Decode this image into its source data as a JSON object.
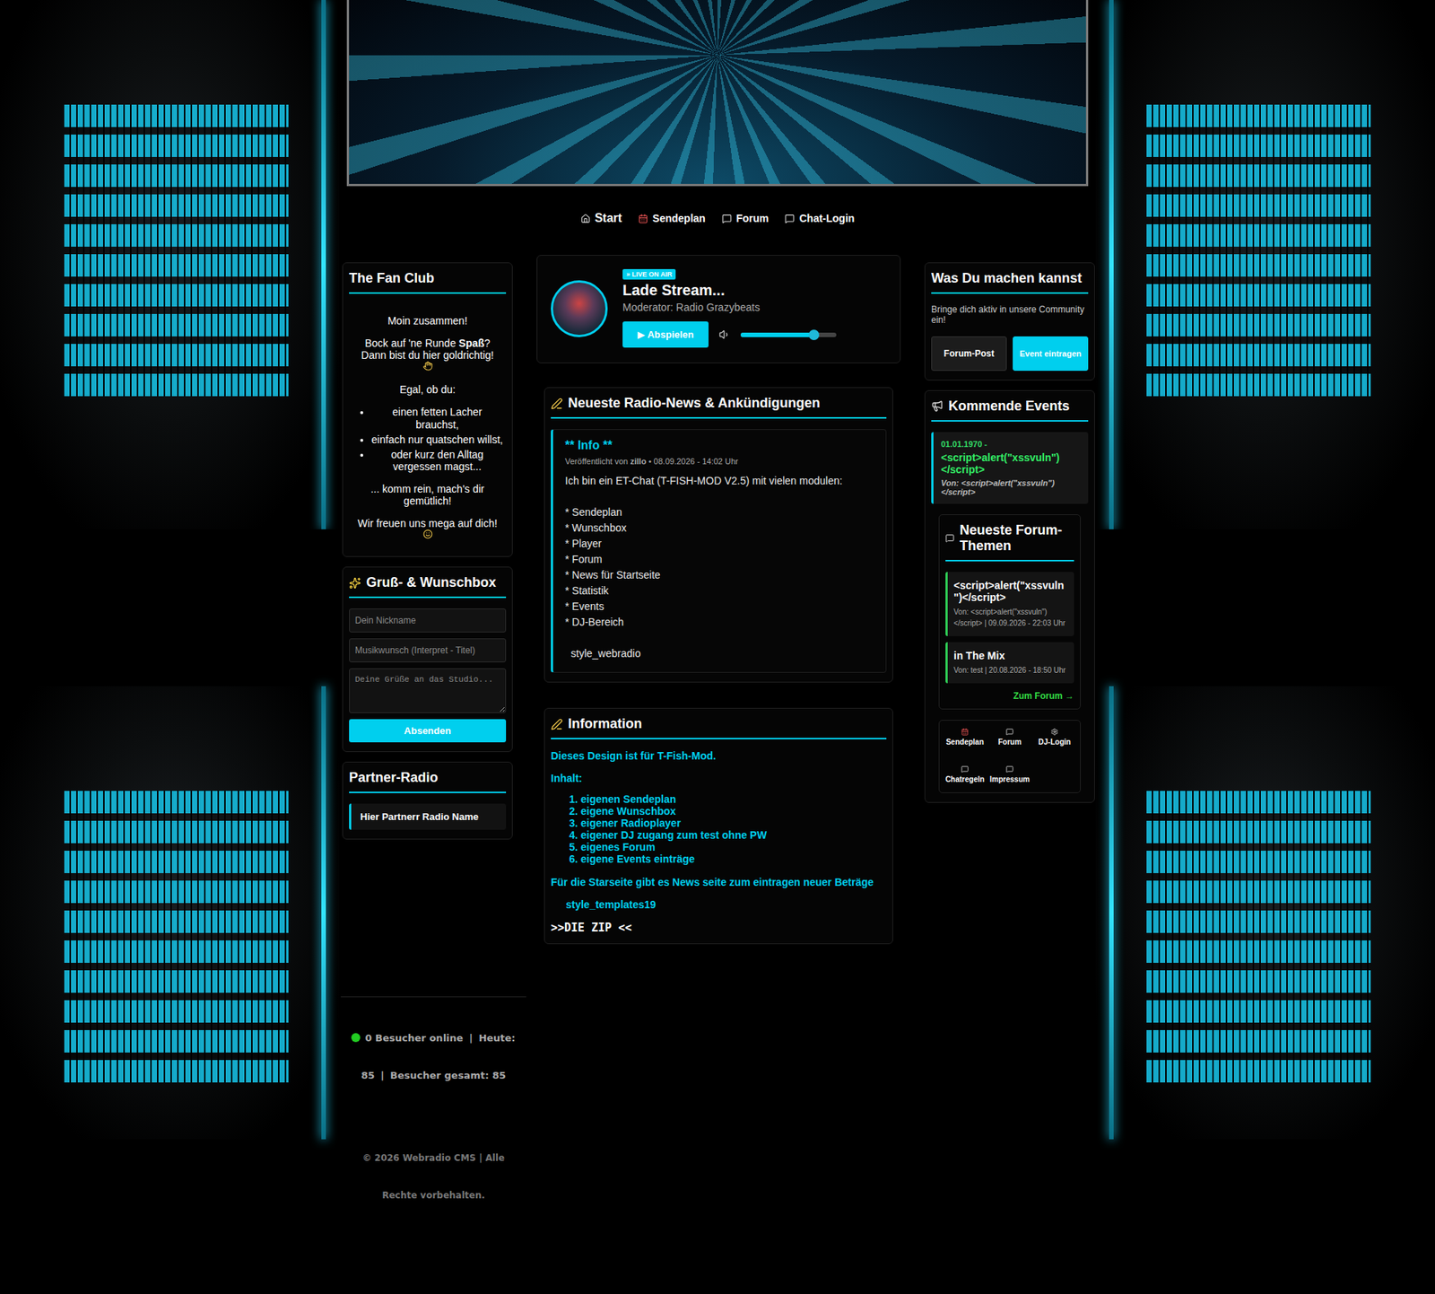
{
  "nav": [
    {
      "label": "Start",
      "selected": true
    },
    {
      "label": "Sendeplan",
      "selected": false
    },
    {
      "label": "Forum",
      "selected": false
    },
    {
      "label": "Chat-Login",
      "selected": false
    }
  ],
  "fan_club": {
    "title": "The Fan Club",
    "greeting": "Moin zusammen!",
    "intro": [
      {
        "text": "Bock auf 'ne Runde ",
        "bold": false
      },
      {
        "text": "Spaß",
        "bold": true
      },
      {
        "text": "? Dann bist du hier goldrichtig!",
        "bold": false
      }
    ],
    "list_title": "Egal, ob du:",
    "items": [
      "einen fetten Lacher brauchst,",
      "einfach nur quatschen willst,",
      "oder kurz den Alltag vergessen magst..."
    ],
    "closing": "... komm rein, mach's dir gemütlich!",
    "outro": "Wir freuen uns mega auf dich!"
  },
  "wishbox": {
    "title": "Gruß- & Wunschbox",
    "fields": [
      {
        "placeholder": "Dein Nickname",
        "kind": "input"
      },
      {
        "placeholder": "Musikwunsch (Interpret - Titel)",
        "kind": "input"
      },
      {
        "placeholder": "Deine Grüße an das Studio...",
        "kind": "textarea"
      }
    ],
    "button": "Absenden"
  },
  "partner_radio": {
    "title": "Partner-Radio",
    "items": [
      {
        "label": "Hier Partnerr Radio Name"
      }
    ]
  },
  "player": {
    "badge": "» LIVE ON AIR",
    "title": "Lade Stream...",
    "moderator": "Moderator: Radio Grazybeats",
    "play_button": {
      "icon": "▶",
      "label": "Abspielen"
    },
    "volume": {
      "level": 0.76
    }
  },
  "news": {
    "title": "Neueste Radio-News & Ankündigungen",
    "posts": [
      {
        "title": "** Info **",
        "meta_prefix": "Veröffentlicht von ",
        "author": "zillo",
        "meta_suffix": " • 08.09.2026 - 14:02 Uhr",
        "body": [
          "Ich bin ein ET-Chat (T-FISH-MOD V2.5) mit vielen modulen:",
          "",
          "* Sendeplan",
          "* Wunschbox",
          "* Player",
          "* Forum",
          "* News für Startseite",
          "* Statistik",
          "* Events",
          "* DJ-Bereich",
          "",
          "  style_webradio"
        ]
      }
    ]
  },
  "info": {
    "title": "Information",
    "intro": "Dieses Design ist für T-Fish-Mod.",
    "list_title": "Inhalt:",
    "items": [
      "eigenen Sendeplan",
      "eigene Wunschbox",
      "eigener Radioplayer",
      "eigener DJ zugang zum test ohne PW",
      "eigenes Forum",
      "eigene Events einträge"
    ],
    "note": "Für die Starseite gibt es News seite zum eintragen neuer Beträge",
    "template": "style_templates19",
    "download": ">>DIE ZIP <<"
  },
  "actions": {
    "title": "Was Du machen kannst",
    "text": "Bringe dich aktiv in unsere Community ein!",
    "buttons": [
      {
        "label": "Forum-Post",
        "kind": "secondary"
      },
      {
        "label": "Event eintragen",
        "kind": "primary"
      }
    ]
  },
  "events": {
    "title": "Kommende Events",
    "items": [
      {
        "date": "01.01.1970 -",
        "title": "<script>alert(\"xssvuln\")</script>",
        "by": "Von: <script>alert(\"xssvuln\")</script>"
      }
    ]
  },
  "forum": {
    "title": "Neueste Forum-Themen",
    "topics": [
      {
        "title": "<script>alert(\"xssvuln\")</script>",
        "meta": "Von: <script>alert(\"xssvuln\")</script> | 09.09.2026 - 22:03 Uhr"
      },
      {
        "title": "in The Mix",
        "meta": "Von: test | 20.08.2026 - 18:50 Uhr"
      }
    ],
    "link": "Zum Forum →"
  },
  "quick_links": [
    {
      "label": "Sendeplan"
    },
    {
      "label": "Forum"
    },
    {
      "label": "DJ-Login"
    },
    {
      "label": "Chatregeln"
    },
    {
      "label": "Impressum"
    }
  ],
  "footer": {
    "online": "0 Besucher online",
    "stats": [
      "Heute: 85",
      "Besucher gesamt: 85"
    ],
    "separator": "|",
    "copyright": "© 2026 Webradio CMS | Alle Rechte vorbehalten."
  }
}
